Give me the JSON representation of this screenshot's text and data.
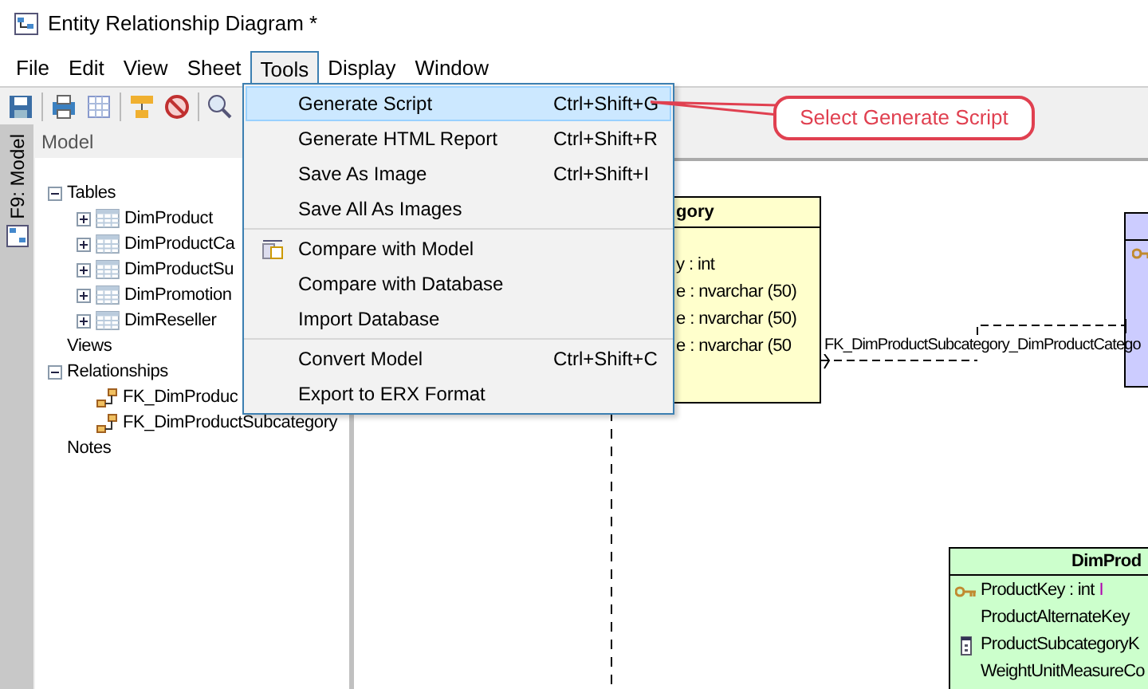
{
  "window": {
    "title": "Entity Relationship Diagram *"
  },
  "menu_bar": [
    {
      "label": "File",
      "selected": false
    },
    {
      "label": "Edit",
      "selected": false
    },
    {
      "label": "View",
      "selected": false
    },
    {
      "label": "Sheet",
      "selected": false
    },
    {
      "label": "Tools",
      "selected": true
    },
    {
      "label": "Display",
      "selected": false
    },
    {
      "label": "Window",
      "selected": false
    }
  ],
  "tools_menu": {
    "groups": [
      [
        {
          "label": "Generate Script",
          "shortcut": "Ctrl+Shift+G",
          "selected": true,
          "icon": false
        },
        {
          "label": "Generate HTML Report",
          "shortcut": "Ctrl+Shift+R",
          "selected": false,
          "icon": false
        },
        {
          "label": "Save As Image",
          "shortcut": "Ctrl+Shift+I",
          "selected": false,
          "icon": false
        },
        {
          "label": "Save All As Images",
          "selected": false,
          "icon": false
        }
      ],
      [
        {
          "label": "Compare with Model",
          "selected": false,
          "icon": true
        },
        {
          "label": "Compare with Database",
          "selected": false,
          "icon": false
        },
        {
          "label": "Import Database",
          "selected": false,
          "icon": false
        }
      ],
      [
        {
          "label": "Convert Model",
          "shortcut": "Ctrl+Shift+C",
          "selected": false,
          "icon": false
        },
        {
          "label": "Export to ERX Format",
          "selected": false,
          "icon": false
        }
      ]
    ]
  },
  "side_tab": {
    "label": "F9: Model"
  },
  "model_panel": {
    "title": "Model",
    "tree": [
      {
        "label": "Tables",
        "expanded": true,
        "children": [
          {
            "label": "DimProduct",
            "kind": "table",
            "expanded": false
          },
          {
            "label": "DimProductCa",
            "kind": "table",
            "expanded": false
          },
          {
            "label": "DimProductSu",
            "kind": "table",
            "expanded": false
          },
          {
            "label": "DimPromotion",
            "kind": "table",
            "expanded": false
          },
          {
            "label": "DimReseller",
            "kind": "table",
            "expanded": false
          }
        ]
      },
      {
        "label": "Views"
      },
      {
        "label": "Relationships",
        "expanded": true,
        "children": [
          {
            "label": "FK_DimProduc",
            "kind": "relationship"
          },
          {
            "label": "FK_DimProductSubcategory",
            "kind": "relationship"
          }
        ]
      },
      {
        "label": "Notes"
      }
    ]
  },
  "diagram": {
    "tables": [
      {
        "header": "gory",
        "color": "#ffffcc",
        "rows": [
          "y : int",
          "e : nvarchar (50)",
          "e : nvarchar (50)",
          "e : nvarchar (50"
        ]
      },
      {
        "color": "#ccccff",
        "rows": [
          {
            "kind": "key"
          }
        ]
      },
      {
        "header": "DimProd",
        "color": "#ccffcc",
        "rows": [
          {
            "text": "ProductKey : int",
            "kind": "key",
            "identity": "I"
          },
          {
            "text": "ProductAlternateKey",
            "kind": "plain"
          },
          {
            "text": "ProductSubcategoryK",
            "kind": "foreign"
          },
          {
            "text": "WeightUnitMeasureCo",
            "kind": "plain"
          }
        ]
      }
    ],
    "relationship_label": "FK_DimProductSubcategory_DimProductCatego"
  },
  "callout": {
    "text": "Select Generate Script"
  }
}
